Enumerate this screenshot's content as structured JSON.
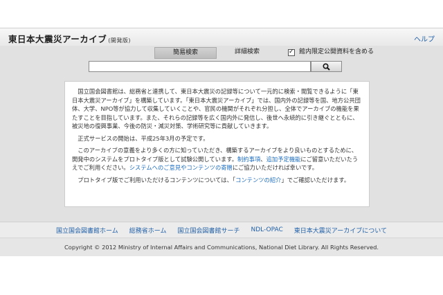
{
  "header": {
    "title": "東日本大震災アーカイブ",
    "edition": "(開発版)",
    "help": "ヘルプ"
  },
  "search": {
    "tab_simple": "簡易検索",
    "tab_detailed": "詳細検索",
    "option_label": "館内限定公開資料を含める",
    "option_checked": true,
    "query": "",
    "button_icon": "search-icon"
  },
  "intro": {
    "p1": "国立国会図書館は、総務省と連携して、東日本大震災の記録等について一元的に検索・閲覧できるように「東日本大震災アーカイブ」を構築しています。「東日本大震災アーカイブ」では、国内外の記録等を国、地方公共団体、大学、NPO等が協力して収集していくことや、官民の機関がそれぞれ分担し、全体でアーカイブの機能を果たすことを目指しています。また、それらの記録等を広く国内外に発信し、後世へ永続的に引き継ぐとともに、被災地の復興事業、今後の防災・減災対策、学術研究等に貢献していきます。",
    "p2": "正式サービスの開始は、平成25年3月の予定です。",
    "p3_a": "このアーカイブの意義をより多くの方に知っていただき、構築するアーカイブをより良いものとするために、開発中のシステムをプロトタイプ版として試験公開しています。",
    "p3_link1": "制約事項",
    "p3_sep": "、",
    "p3_link2": "追加予定機能",
    "p3_b": "にご留意いただいたうえでご利用ください。",
    "p3_link3": "システムへのご意見やコンテンツの寄贈",
    "p3_c": "にご協力いただければ幸いです。",
    "p4_a": "プロトタイプ版でご利用いただけるコンテンツについては、「",
    "p4_link": "コンテンツの紹介",
    "p4_b": "」でご確認いただけます。"
  },
  "footer": {
    "links": [
      "国立国会図書館ホーム",
      "総務省ホーム",
      "国立国会図書館サーチ",
      "NDL-OPAC",
      "東日本大震災アーカイブについて"
    ],
    "copyright": "Copyright © 2012 Ministry of Internal Affairs and Communications, National Diet Library. All Rights Reserved."
  },
  "colors": {
    "link": "#1f5fa8",
    "search_area_bg": "#e1e1e1"
  }
}
